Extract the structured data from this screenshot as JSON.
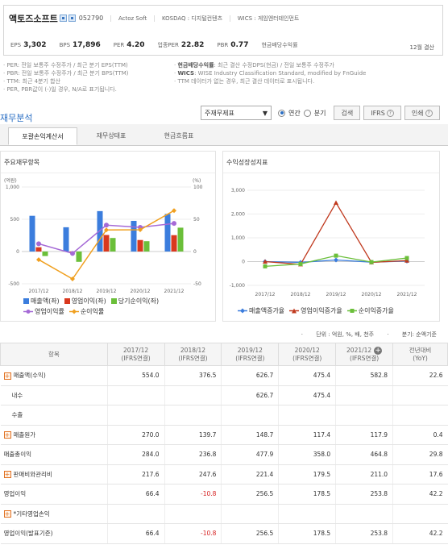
{
  "header": {
    "company": "액토즈소프트",
    "code": "052790",
    "english_name": "Actoz Soft",
    "kosdaq": "KOSDAQ : 디지털컨텐츠",
    "wics": "WICS : 게임엔터테인먼트",
    "stats": [
      {
        "label": "EPS",
        "value": "3,302"
      },
      {
        "label": "BPS",
        "value": "17,896"
      },
      {
        "label": "PER",
        "value": "4.20"
      },
      {
        "label": "업종PER",
        "value": "22.82"
      },
      {
        "label": "PBR",
        "value": "0.77"
      },
      {
        "label": "현금배당수익률",
        "value": ""
      }
    ],
    "settlement": "12월 결산"
  },
  "notes": {
    "left": [
      "· PER: 전일 보통주 수정주가 / 최근 분기 EPS(TTM)",
      "· PBR: 전일 보통주 수정주가 / 최근 분기 BPS(TTM)",
      "· TTM: 최근 4분기 합산",
      "· PER, PBR값이 (-)일 경우, N/A로 표기됩니다."
    ],
    "right_bold": [
      "현금배당수익률",
      "WICS"
    ],
    "right": [
      ": 최근 결산 수정DPS(현금) / 전일 보통주 수정주가",
      ": WISE Industry Classification Standard, modified by FnGuide",
      "· TTM 데이터가 없는 경우, 최근 결산 데이터로 표시됩니다."
    ]
  },
  "section": {
    "title": "재무분석",
    "select": "주재무제표",
    "radio_annual": "연간",
    "radio_quarter": "분기",
    "search_btn": "검색",
    "ifrs_btn": "IFRS",
    "print_btn": "인쇄"
  },
  "tabs": [
    "포괄손익계산서",
    "재무상태표",
    "현금흐름표"
  ],
  "chart_left": {
    "title": "주요재무항목",
    "unit_left": "(억원)",
    "unit_right": "(%)",
    "y_left_ticks": [
      "1,000",
      "500",
      "0",
      "-500"
    ],
    "y_right_ticks": [
      "100",
      "50",
      "0",
      "-50"
    ],
    "legend": [
      "매출액(좌)",
      "영업이익(좌)",
      "당기순이익(좌)",
      "영업이익률",
      "순이익률"
    ]
  },
  "chart_right": {
    "title": "수익성장성지표",
    "y_ticks": [
      "3,000",
      "2,000",
      "1,000",
      "0",
      "-1,000"
    ],
    "legend": [
      "매출액증가율",
      "영업이익증가율",
      "순이익증가율"
    ]
  },
  "chart_data": [
    {
      "type": "bar",
      "title": "주요재무항목",
      "categories": [
        "2017/12",
        "2018/12",
        "2019/12",
        "2020/12",
        "2021/12"
      ],
      "ylim": [
        -500,
        1000
      ],
      "y2lim": [
        -50,
        100
      ],
      "series": [
        {
          "name": "매출액(좌)",
          "type": "bar",
          "axis": "left",
          "values": [
            554.0,
            376.5,
            626.7,
            475.4,
            582.8
          ],
          "color": "#3b7ddd"
        },
        {
          "name": "영업이익(좌)",
          "type": "bar",
          "axis": "left",
          "values": [
            66.4,
            -10.8,
            256.5,
            178.5,
            253.8
          ],
          "color": "#d9381e"
        },
        {
          "name": "당기순이익(좌)",
          "type": "bar",
          "axis": "left",
          "values": [
            -70,
            -160,
            210,
            160,
            370
          ],
          "color": "#6bbf3a"
        },
        {
          "name": "영업이익률",
          "type": "line",
          "axis": "right",
          "values": [
            12.0,
            -2.9,
            40.9,
            37.5,
            43.6
          ],
          "color": "#a56ad6"
        },
        {
          "name": "순이익률",
          "type": "line",
          "axis": "right",
          "values": [
            -12.6,
            -42.5,
            33.5,
            33.7,
            63.5
          ],
          "color": "#f0a020"
        }
      ]
    },
    {
      "type": "line",
      "title": "수익성장성지표",
      "categories": [
        "2017/12",
        "2018/12",
        "2019/12",
        "2020/12",
        "2021/12"
      ],
      "ylim": [
        -1000,
        3000
      ],
      "series": [
        {
          "name": "매출액증가율",
          "values": [
            0,
            -32.0,
            66.5,
            -24.1,
            22.6
          ],
          "color": "#3b7ddd"
        },
        {
          "name": "영업이익증가율",
          "values": [
            0,
            -116.3,
            2475,
            -30.4,
            42.2
          ],
          "color": "#c0391e"
        },
        {
          "name": "순이익증가율",
          "values": [
            -200,
            -100,
            250,
            -20,
            150
          ],
          "color": "#6bbf3a"
        }
      ]
    }
  ],
  "table_meta": {
    "unit": "단위 : 억원, %, 배, 천주",
    "basis": "분기: 순액기준"
  },
  "table": {
    "headers": [
      {
        "top": "항목",
        "bottom": ""
      },
      {
        "top": "2017/12",
        "bottom": "(IFRS연결)"
      },
      {
        "top": "2018/12",
        "bottom": "(IFRS연결)"
      },
      {
        "top": "2019/12",
        "bottom": "(IFRS연결)"
      },
      {
        "top": "2020/12",
        "bottom": "(IFRS연결)"
      },
      {
        "top": "2021/12",
        "bottom": "(IFRS연결)"
      },
      {
        "top": "전년대비",
        "bottom": "(YoY)"
      }
    ],
    "rows": [
      {
        "label": "매출액(수익)",
        "expand": true,
        "indent": false,
        "values": [
          "554.0",
          "376.5",
          "626.7",
          "475.4",
          "582.8",
          "22.6"
        ]
      },
      {
        "label": "내수",
        "expand": false,
        "indent": true,
        "values": [
          "",
          "",
          "626.7",
          "475.4",
          "",
          ""
        ]
      },
      {
        "label": "수출",
        "expand": false,
        "indent": true,
        "values": [
          "",
          "",
          "",
          "",
          "",
          ""
        ]
      },
      {
        "label": "매출원가",
        "expand": true,
        "indent": false,
        "values": [
          "270.0",
          "139.7",
          "148.7",
          "117.4",
          "117.9",
          "0.4"
        ]
      },
      {
        "label": "매출총이익",
        "expand": false,
        "indent": false,
        "values": [
          "284.0",
          "236.8",
          "477.9",
          "358.0",
          "464.8",
          "29.8"
        ]
      },
      {
        "label": "판매비와관리비",
        "expand": true,
        "indent": false,
        "values": [
          "217.6",
          "247.6",
          "221.4",
          "179.5",
          "211.0",
          "17.6"
        ]
      },
      {
        "label": "영업이익",
        "expand": false,
        "indent": false,
        "values": [
          "66.4",
          "-10.8",
          "256.5",
          "178.5",
          "253.8",
          "42.2"
        ]
      },
      {
        "label": "*기타영업손익",
        "expand": true,
        "indent": false,
        "values": [
          "",
          "",
          "",
          "",
          "",
          ""
        ]
      },
      {
        "label": "영업이익(발표기준)",
        "expand": false,
        "indent": false,
        "values": [
          "66.4",
          "-10.8",
          "256.5",
          "178.5",
          "253.8",
          "42.2"
        ]
      }
    ]
  }
}
